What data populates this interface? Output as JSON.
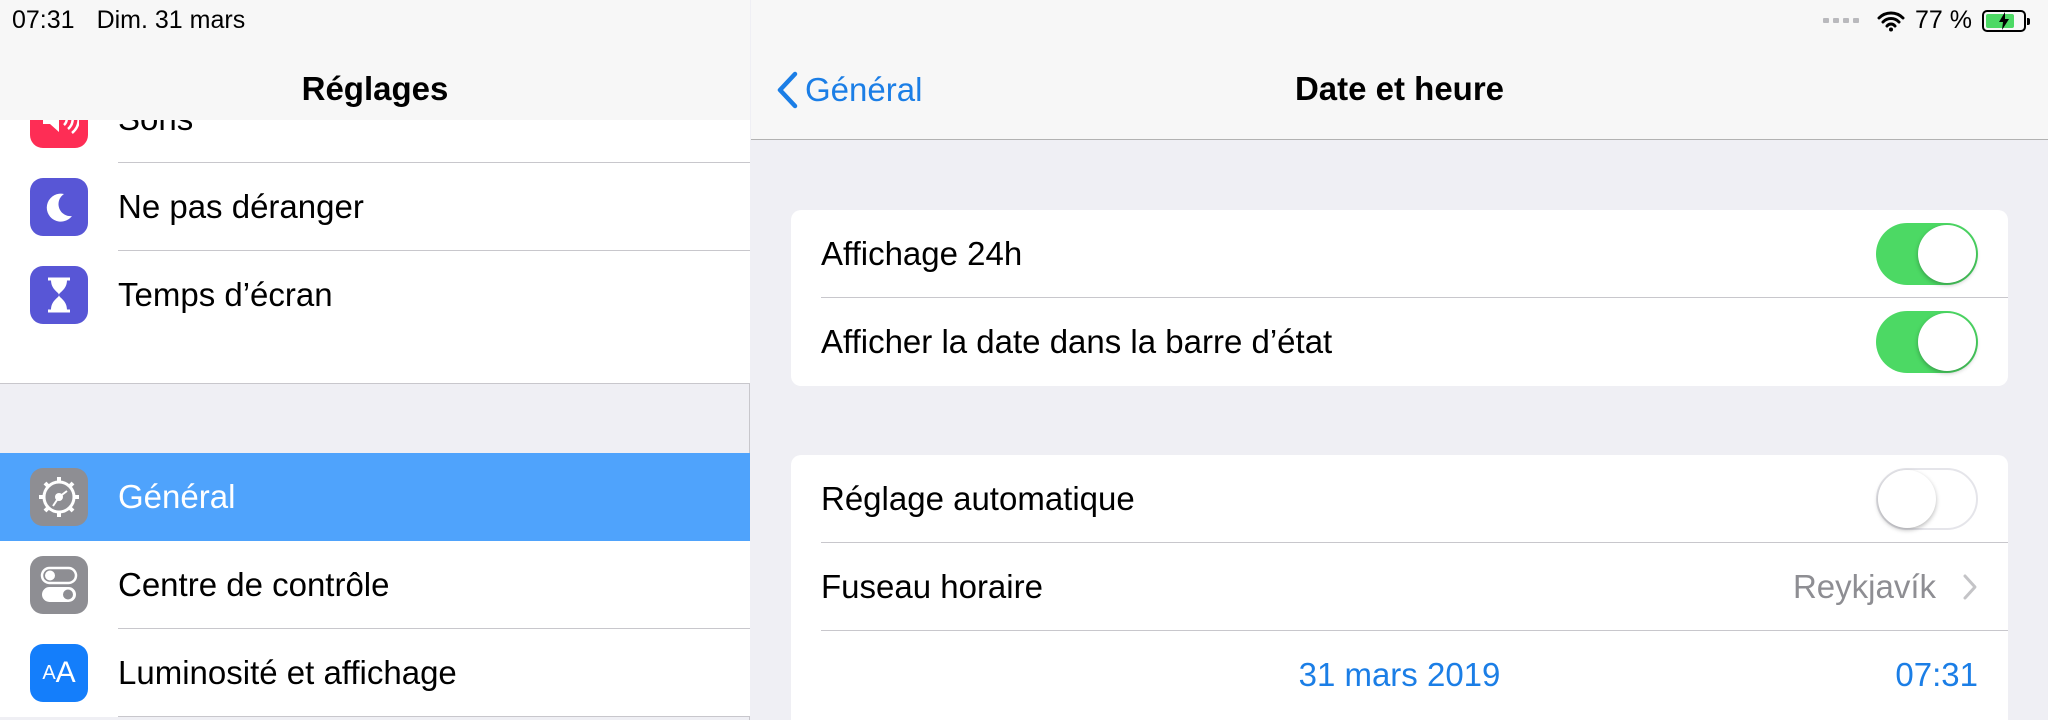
{
  "status_bar": {
    "time": "07:31",
    "date": "Dim. 31 mars",
    "battery": "77 %",
    "battery_level": 0.77
  },
  "sidebar": {
    "title": "Réglages",
    "items_top": [
      {
        "label": "Sons",
        "icon": "speaker-icon",
        "color": "#fe2d55"
      },
      {
        "label": "Ne pas déranger",
        "icon": "moon-icon",
        "color": "#5856d6"
      },
      {
        "label": "Temps d’écran",
        "icon": "hourglass-icon",
        "color": "#5856d6"
      }
    ],
    "items_bottom": [
      {
        "label": "Général",
        "icon": "gear-icon",
        "color": "#8e8e93",
        "selected": true
      },
      {
        "label": "Centre de contrôle",
        "icon": "toggles-icon",
        "color": "#8e8e93"
      },
      {
        "label": "Luminosité et affichage",
        "icon": "text-size-icon",
        "color": "#147efb",
        "icon_text": "AA"
      }
    ]
  },
  "detail": {
    "back_label": "Général",
    "title": "Date et heure",
    "group1": [
      {
        "label": "Affichage 24h",
        "toggle": true
      },
      {
        "label": "Afficher la date dans la barre d’état",
        "toggle": true
      }
    ],
    "group2": {
      "auto_label": "Réglage automatique",
      "auto_toggle": false,
      "timezone_label": "Fuseau horaire",
      "timezone_value": "Reykjavík",
      "date_value": "31 mars 2019",
      "time_value": "07:31"
    }
  },
  "colors": {
    "accent": "#1b7ee6",
    "selection": "#4fa3fc",
    "toggle_on": "#4cd964"
  }
}
